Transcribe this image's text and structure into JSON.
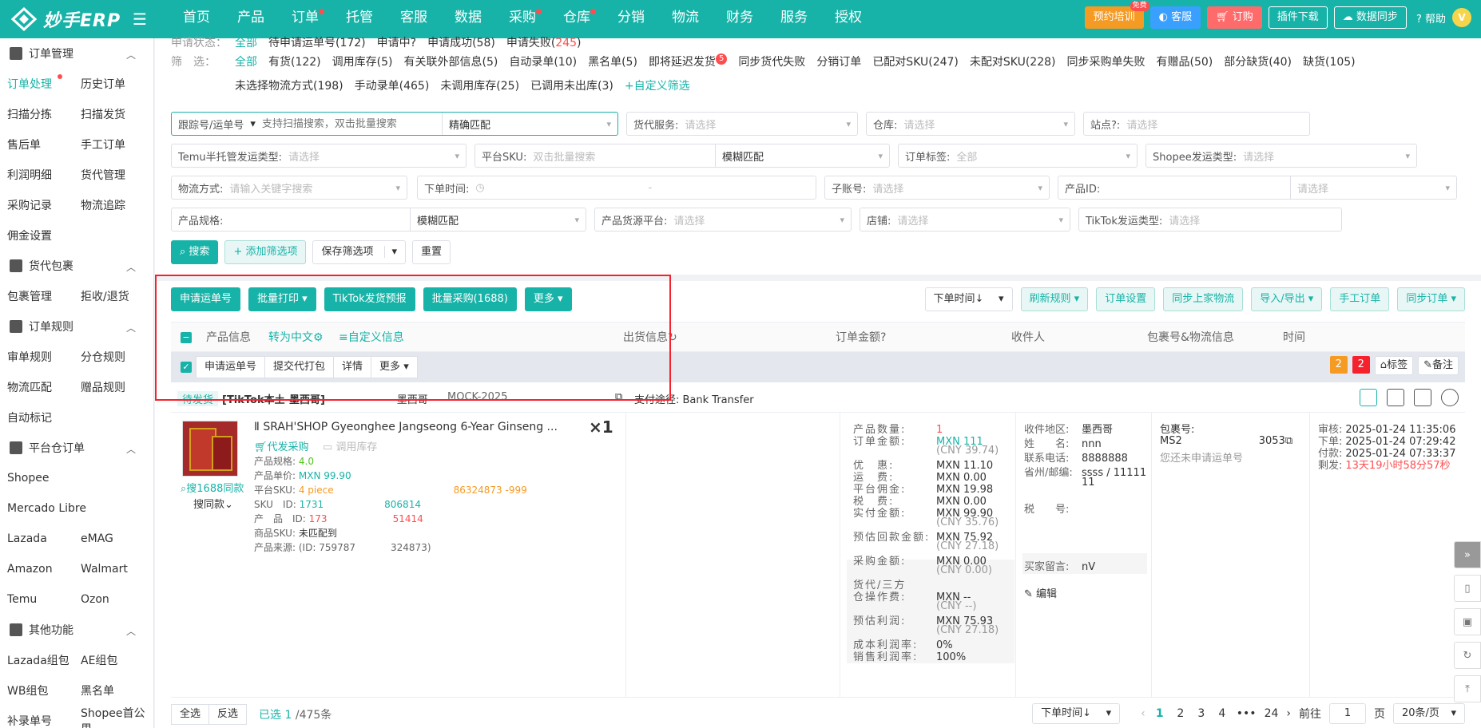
{
  "app": {
    "logo_text": "妙手ERP"
  },
  "nav": [
    "首页",
    "产品",
    "订单",
    "托管",
    "客服",
    "数据",
    "采购",
    "仓库",
    "分销",
    "物流",
    "财务",
    "服务",
    "授权"
  ],
  "nav_dots": [
    false,
    false,
    true,
    false,
    false,
    false,
    true,
    true,
    false,
    false,
    false,
    false,
    false
  ],
  "top_actions": {
    "training": "预约培训",
    "free_badge": "免费",
    "service": "客服",
    "order": "订购",
    "plugin": "插件下载",
    "sync": "数据同步",
    "help": "帮助",
    "avatar": "V"
  },
  "sidebar": {
    "g1": "订单管理",
    "r1": [
      "订单处理",
      "历史订单"
    ],
    "r2": [
      "扫描分拣",
      "扫描发货"
    ],
    "r3": [
      "售后单",
      "手工订单"
    ],
    "r4": [
      "利润明细",
      "货代管理"
    ],
    "r5": [
      "采购记录",
      "物流追踪"
    ],
    "r6": [
      "佣金设置",
      ""
    ],
    "g2": "货代包裹",
    "r7": [
      "包裹管理",
      "拒收/退货"
    ],
    "g3": "订单规则",
    "r8": [
      "审单规则",
      "分仓规则"
    ],
    "r9": [
      "物流匹配",
      "赠品规则"
    ],
    "r10": [
      "自动标记",
      ""
    ],
    "g4": "平台仓订单",
    "r11": [
      "Shopee",
      ""
    ],
    "r12": [
      "Mercado Libre",
      ""
    ],
    "r13": [
      "Lazada",
      "eMAG"
    ],
    "r14": [
      "Amazon",
      "Walmart"
    ],
    "r15": [
      "Temu",
      "Ozon"
    ],
    "g5": "其他功能",
    "r16": [
      "Lazada组包",
      "AE组包"
    ],
    "r17": [
      "WB组包",
      "黑名单"
    ],
    "r18": [
      "补录单号",
      "Shopee首公里"
    ]
  },
  "filters": {
    "status_label": "申请状态：",
    "status_opts": [
      "全部",
      "待申请运单号(172)",
      "申请中",
      "申请成功(58)",
      "申请失败("
    ],
    "status_fail_count": "245",
    "status_close": ")",
    "filter_label": "筛　选：",
    "row2": [
      "全部",
      "有货(122)",
      "调用库存(5)",
      "有关联外部信息(5)",
      "自动录单(10)",
      "黑名单(5)",
      "即将延迟发货",
      "同步货代失败",
      "分销订单",
      "已配对SKU(247)",
      "未配对SKU(228)",
      "同步采购单失败",
      "有赠品(50)",
      "部分缺货(40)",
      "缺货(105)"
    ],
    "delay_badge": "5",
    "row3": [
      "未选择物流方式(198)",
      "手动录单(465)",
      "未调用库存(25)",
      "已调用未出库(3)",
      "+自定义筛选"
    ]
  },
  "search": {
    "tracking_label": "跟踪号/运单号",
    "tracking_ph": "支持扫描搜索，双击批量搜索",
    "exact": "精确匹配",
    "forwarder_label": "货代服务:",
    "warehouse_label": "仓库:",
    "site_label": "站点",
    "select_ph": "请选择",
    "temu_label": "Temu半托管发运类型:",
    "platform_sku_label": "平台SKU:",
    "platform_sku_ph": "双击批量搜索",
    "fuzzy": "模糊匹配",
    "order_tag_label": "订单标签:",
    "all": "全部",
    "shopee_label": "Shopee发运类型:",
    "logistics_label": "物流方式:",
    "logistics_ph": "请输入关键字搜索",
    "order_time_label": "下单时间:",
    "dash": "-",
    "sub_account_label": "子账号:",
    "product_id_label": "产品ID:",
    "spec_label": "产品规格:",
    "source_label": "产品货源平台:",
    "store_label": "店铺:",
    "tiktok_label": "TikTok发运类型:"
  },
  "buttons": {
    "search": "搜索",
    "add_filter": "+ 添加筛选项",
    "save_filter": "保存筛选项",
    "reset": "重置"
  },
  "actions_left": [
    "申请运单号",
    "批量打印",
    "TikTok发货预报",
    "批量采购(1688)",
    "更多"
  ],
  "actions_right": [
    "下单时间↓",
    "刷新规则",
    "订单设置",
    "同步上家物流",
    "导入/导出",
    "手工订单",
    "同步订单"
  ],
  "table_head": {
    "product": "产品信息",
    "translate": "转为中文",
    "custom": "自定义信息",
    "ship": "出货信息",
    "amount": "订单金额",
    "receiver": "收件人",
    "package": "包裹号&物流信息",
    "time": "时间"
  },
  "subbar": {
    "buttons": [
      "申请运单号",
      "提交代打包",
      "详情",
      "更多"
    ],
    "n1": "2",
    "n2": "2",
    "tag": "标签",
    "note": "备注"
  },
  "order": {
    "status": "待发货",
    "shop": "[TikTok本土-墨西哥]",
    "shop2": "-墨西哥",
    "mock": "MOCK-2025",
    "pay": "支付途径: Bank Transfer",
    "title": "Ⅱ SRAH'SHOP Gyeonghee Jangseong 6-Year Ginseng ...",
    "qty": "×1",
    "daifa": "代发采购",
    "use_stock": "调用库存",
    "search1688": "搜1688同款",
    "search_same": "搜同款",
    "spec_k": "产品规格:",
    "spec_v": "4.0",
    "price_k": "产品单价:",
    "price_v": "MXN 99.90",
    "psku_k": "平台SKU:",
    "psku_v": "4 piece",
    "psku_tail": "86324873 -999",
    "sku_k": "SKU　ID:",
    "sku_v": "1731",
    "sku_tail": "806814",
    "pid_k": "产　品　ID:",
    "pid_v": "173",
    "pid_tail": "51414",
    "msku_k": "商品SKU:",
    "msku_v": "未匹配到",
    "src_k": "产品来源:",
    "src_v": "(ID: 759787",
    "src_tail": "324873)"
  },
  "amount": [
    [
      "产品数量:",
      "1",
      ""
    ],
    [
      "订单金额:",
      "MXN 111",
      "(CNY 39.74)"
    ],
    [
      "优　惠:",
      "MXN 11.10",
      ""
    ],
    [
      "运　费:",
      "MXN 0.00",
      ""
    ],
    [
      "平台佣金:",
      "MXN 19.98",
      ""
    ],
    [
      "税　费:",
      "MXN 0.00",
      ""
    ],
    [
      "实付金额:",
      "MXN 99.90",
      "(CNY 35.76)"
    ],
    [
      "预估回款金额:",
      "MXN 75.92",
      "(CNY 27.18)"
    ],
    [
      "采购金额:",
      "MXN 0.00",
      "(CNY 0.00)"
    ],
    [
      "货代/三方",
      "",
      ""
    ],
    [
      "仓操作费:",
      "MXN --",
      "(CNY --)"
    ],
    [
      "预估利润:",
      "MXN 75.93",
      "(CNY 27.18)"
    ],
    [
      "成本利润率:",
      "0%",
      ""
    ],
    [
      "销售利润率:",
      "100%",
      ""
    ]
  ],
  "receiver": {
    "area_k": "收件地区:",
    "area_v": "墨西哥",
    "name_k": "姓　　名:",
    "name_v": "nnn",
    "phone_k": "联系电话:",
    "phone_v": "8888888",
    "prov_k": "省州/邮编:",
    "prov_v": "ssss / 11111",
    "prov_v2": "11",
    "tax_k": "税　　号:",
    "msg_k": "买家留言:",
    "msg_v": "nV",
    "edit": "编辑"
  },
  "package": {
    "label": "包裹号:",
    "no": "MS2",
    "no_tail": "3053",
    "note": "您还未申请运单号"
  },
  "times": [
    [
      "审核:",
      "2025-01-24 11:35:06"
    ],
    [
      "下单:",
      "2025-01-24 07:29:42"
    ],
    [
      "付款:",
      "2025-01-24 07:33:37"
    ],
    [
      "剩发:",
      "13天19小时58分57秒"
    ]
  ],
  "footer": {
    "all": "全选",
    "invert": "反选",
    "selected": "已选",
    "sel_count": "1",
    "total": "/475条",
    "sort": "下单时间↓",
    "pages": [
      "1",
      "2",
      "3",
      "4",
      "•••",
      "24"
    ],
    "goto": "前往",
    "page_in": "1",
    "page_unit": "页",
    "size": "20条/页"
  }
}
